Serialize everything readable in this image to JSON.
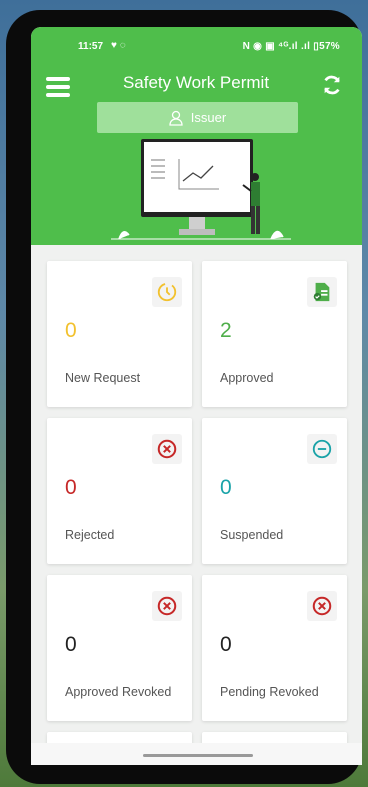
{
  "status_bar": {
    "time": "11:57",
    "icons": "♥ ◌",
    "right": "N ◉ ▣ ⁴ᴳ.ıl .ıl ▯57%"
  },
  "header": {
    "title": "Safety Work Permit",
    "role": "Issuer",
    "menu_icon": "hamburger-icon",
    "refresh_icon": "refresh-icon",
    "color": "#4fbe4b"
  },
  "cards": [
    {
      "count": "0",
      "label": "New Request",
      "icon": "clock-icon",
      "color": "#f2c12e"
    },
    {
      "count": "2",
      "label": "Approved",
      "icon": "approved-document-icon",
      "color": "#4fae4a"
    },
    {
      "count": "0",
      "label": "Rejected",
      "icon": "x-circle-icon",
      "color": "#c62828"
    },
    {
      "count": "0",
      "label": "Suspended",
      "icon": "minus-circle-icon",
      "color": "#1aa3a8"
    },
    {
      "count": "0",
      "label": "Approved Revoked",
      "icon": "x-circle-icon",
      "color": "#222222"
    },
    {
      "count": "0",
      "label": "Pending Revoked",
      "icon": "x-circle-icon",
      "color": "#222222"
    }
  ]
}
